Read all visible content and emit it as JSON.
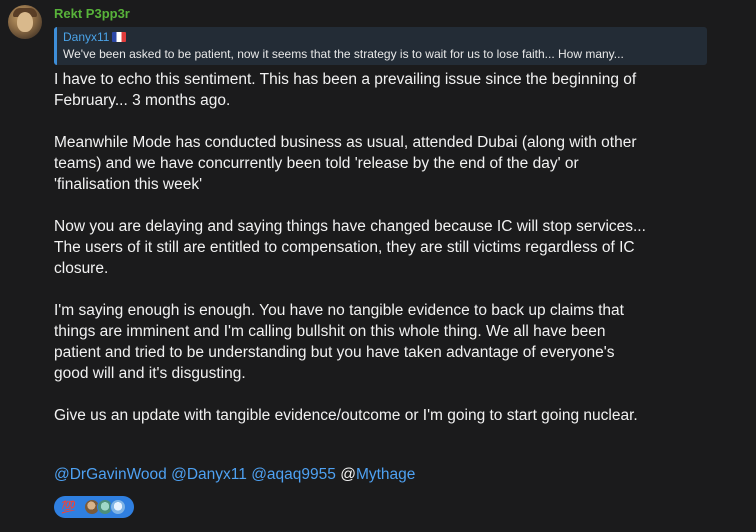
{
  "message": {
    "sender": "Rekt P3pp3r",
    "reply": {
      "name": "Danyx11",
      "flag": "france-flag-icon",
      "text": "We've been asked to be patient, now it seems that the strategy is to wait for us to lose faith... How many..."
    },
    "paragraphs": [
      "I have to echo this sentiment. This has been a prevailing issue since the beginning of\nFebruary... 3 months ago.",
      "Meanwhile Mode has conducted business as usual, attended Dubai (along with other\nteams) and we have concurrently been told 'release by the end of the day' or\n'finalisation this week'",
      "Now you are delaying and saying things have changed because IC will stop services...\nThe users of it still are entitled to compensation, they are still victims regardless of IC\nclosure.",
      "I'm saying enough is enough. You have no tangible evidence to back up claims that\nthings are imminent and I'm calling bullshit on this whole thing. We all have been\npatient and tried to be understanding but you have taken advantage of everyone's\ngood will and it's disgusting.",
      "Give us an update with tangible evidence/outcome or I'm going to start going nuclear."
    ],
    "mentions": [
      "@DrGavinWood",
      "@Danyx11",
      "@aqaq9955"
    ],
    "mention_plain_at": "@",
    "mention_last": "Mythage",
    "reaction": {
      "emoji": "💯",
      "reactor_icons": [
        "reactor-avatar-1-icon",
        "reactor-avatar-2-icon",
        "reactor-avatar-3-icon"
      ]
    }
  },
  "colors": {
    "background": "#1b1b1c",
    "sender": "#58b33a",
    "reply_name": "#4aa3e8",
    "reply_bg": "#232c36",
    "mention": "#4ea1f2",
    "reaction_bg": "#2f7fe0",
    "text": "#f2f2f2"
  }
}
